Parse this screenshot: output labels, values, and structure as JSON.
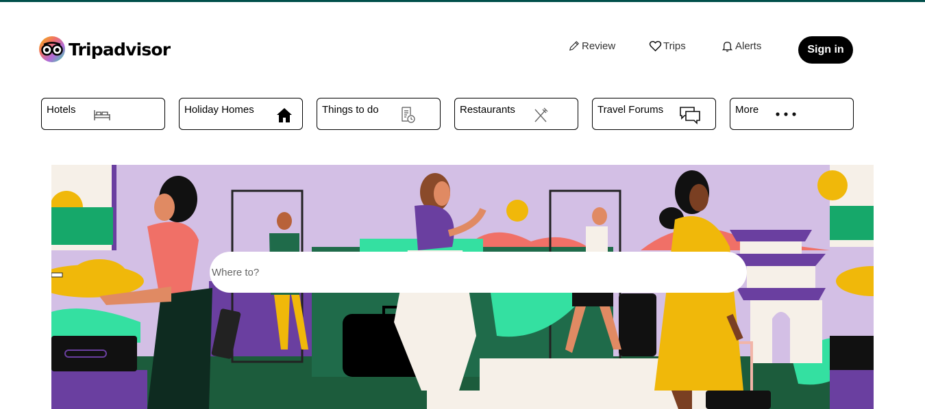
{
  "brand": {
    "name": "Tripadvisor"
  },
  "nav": {
    "review_label": "Review",
    "trips_label": "Trips",
    "alerts_label": "Alerts",
    "signin_label": "Sign in"
  },
  "categories": [
    {
      "label": "Hotels",
      "icon": "bed-icon"
    },
    {
      "label": "Holiday Homes",
      "icon": "house-icon"
    },
    {
      "label": "Things to do",
      "icon": "ticket-clock-icon"
    },
    {
      "label": "Restaurants",
      "icon": "utensils-icon"
    },
    {
      "label": "Travel Forums",
      "icon": "chat-bubbles-icon"
    },
    {
      "label": "More",
      "icon": "more-dots-icon"
    }
  ],
  "search": {
    "placeholder": "Where to?"
  },
  "colors": {
    "brand_green": "#004f4a",
    "hero_lilac": "#d3bfe5",
    "accent_yellow": "#f0b80a",
    "accent_green": "#34e0a1",
    "accent_purple": "#6a3fa0",
    "accent_coral": "#f07067"
  }
}
